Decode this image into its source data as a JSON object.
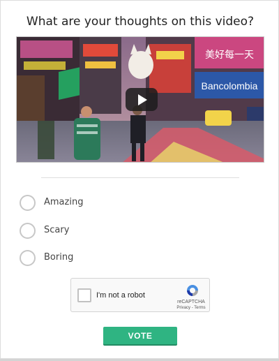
{
  "poll": {
    "question": "What are your thoughts on this video?",
    "options": [
      {
        "label": "Amazing"
      },
      {
        "label": "Scary"
      },
      {
        "label": "Boring"
      }
    ]
  },
  "video": {
    "sign_text": "Bancolombia",
    "sign_text_cjk": "美好每一天"
  },
  "captcha": {
    "label": "I'm not a robot",
    "brand": "reCAPTCHA",
    "links": "Privacy - Terms"
  },
  "actions": {
    "vote_label": "VOTE"
  },
  "colors": {
    "accent": "#2fb482",
    "radio_border": "#c7c7c7"
  }
}
